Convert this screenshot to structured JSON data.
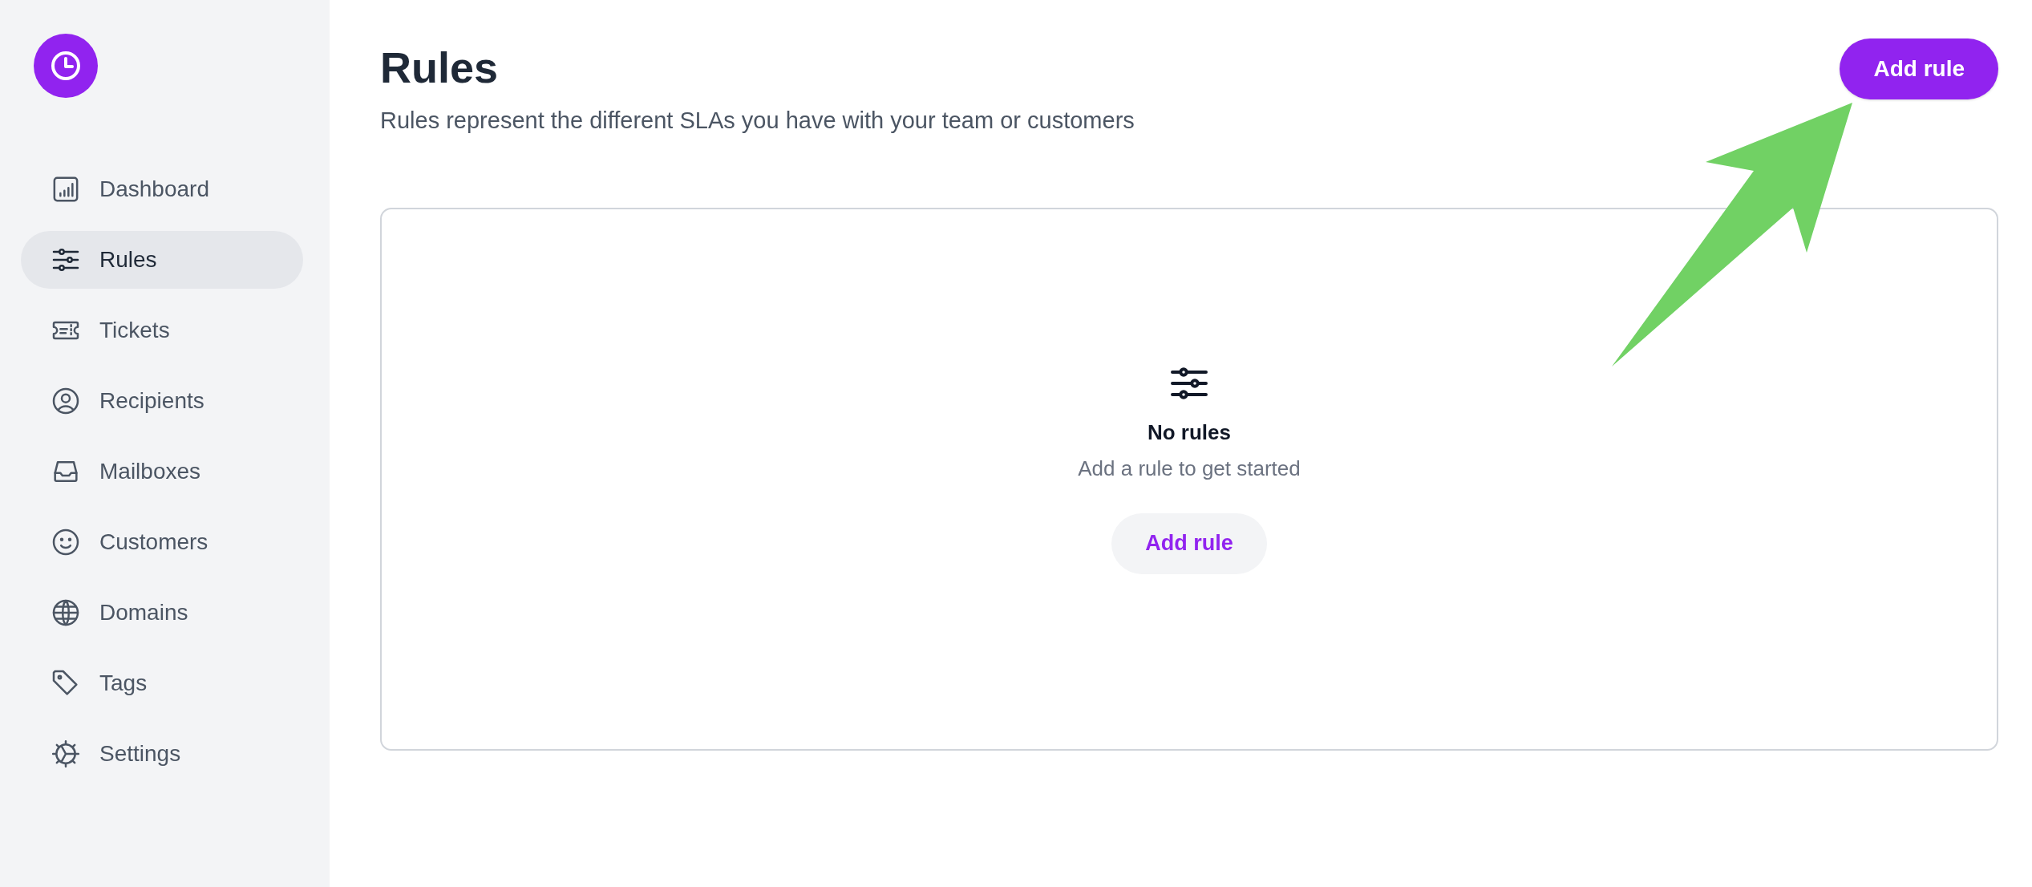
{
  "sidebar": {
    "items": [
      {
        "label": "Dashboard",
        "selected": false
      },
      {
        "label": "Rules",
        "selected": true
      },
      {
        "label": "Tickets",
        "selected": false
      },
      {
        "label": "Recipients",
        "selected": false
      },
      {
        "label": "Mailboxes",
        "selected": false
      },
      {
        "label": "Customers",
        "selected": false
      },
      {
        "label": "Domains",
        "selected": false
      },
      {
        "label": "Tags",
        "selected": false
      },
      {
        "label": "Settings",
        "selected": false
      }
    ]
  },
  "header": {
    "title": "Rules",
    "subtitle": "Rules represent the different SLAs you have with your team or customers",
    "button": "Add rule"
  },
  "empty_state": {
    "title": "No rules",
    "message": "Add a rule to get started",
    "button": "Add rule"
  }
}
